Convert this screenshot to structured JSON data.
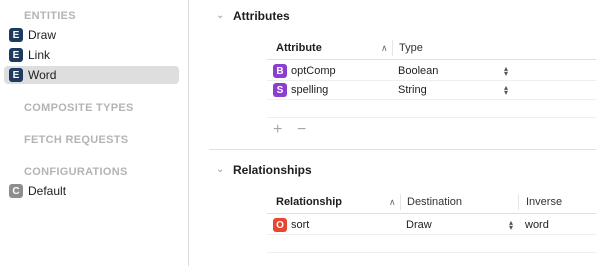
{
  "sidebar": {
    "entities_title": "ENTITIES",
    "entities": [
      {
        "badge": "E",
        "label": "Draw"
      },
      {
        "badge": "E",
        "label": "Link"
      },
      {
        "badge": "E",
        "label": "Word"
      }
    ],
    "composite_title": "COMPOSITE TYPES",
    "fetch_title": "FETCH REQUESTS",
    "config_title": "CONFIGURATIONS",
    "configurations": [
      {
        "badge": "C",
        "label": "Default"
      }
    ]
  },
  "attributes": {
    "title": "Attributes",
    "col_attribute": "Attribute",
    "col_type": "Type",
    "rows": [
      {
        "badge": "B",
        "name": "optComp",
        "type": "Boolean"
      },
      {
        "badge": "S",
        "name": "spelling",
        "type": "String"
      }
    ],
    "add_symbol": "+",
    "remove_symbol": "−"
  },
  "relationships": {
    "title": "Relationships",
    "col_relationship": "Relationship",
    "col_destination": "Destination",
    "col_inverse": "Inverse",
    "rows": [
      {
        "badge": "O",
        "name": "sort",
        "destination": "Draw",
        "inverse": "word"
      }
    ]
  },
  "colors": {
    "entity_badge": "#1e3a5f",
    "attribute_badge": "#8b3fd1",
    "relationship_badge": "#e8462f",
    "config_badge": "#8e8e8e",
    "selected_row": "#dedede"
  }
}
